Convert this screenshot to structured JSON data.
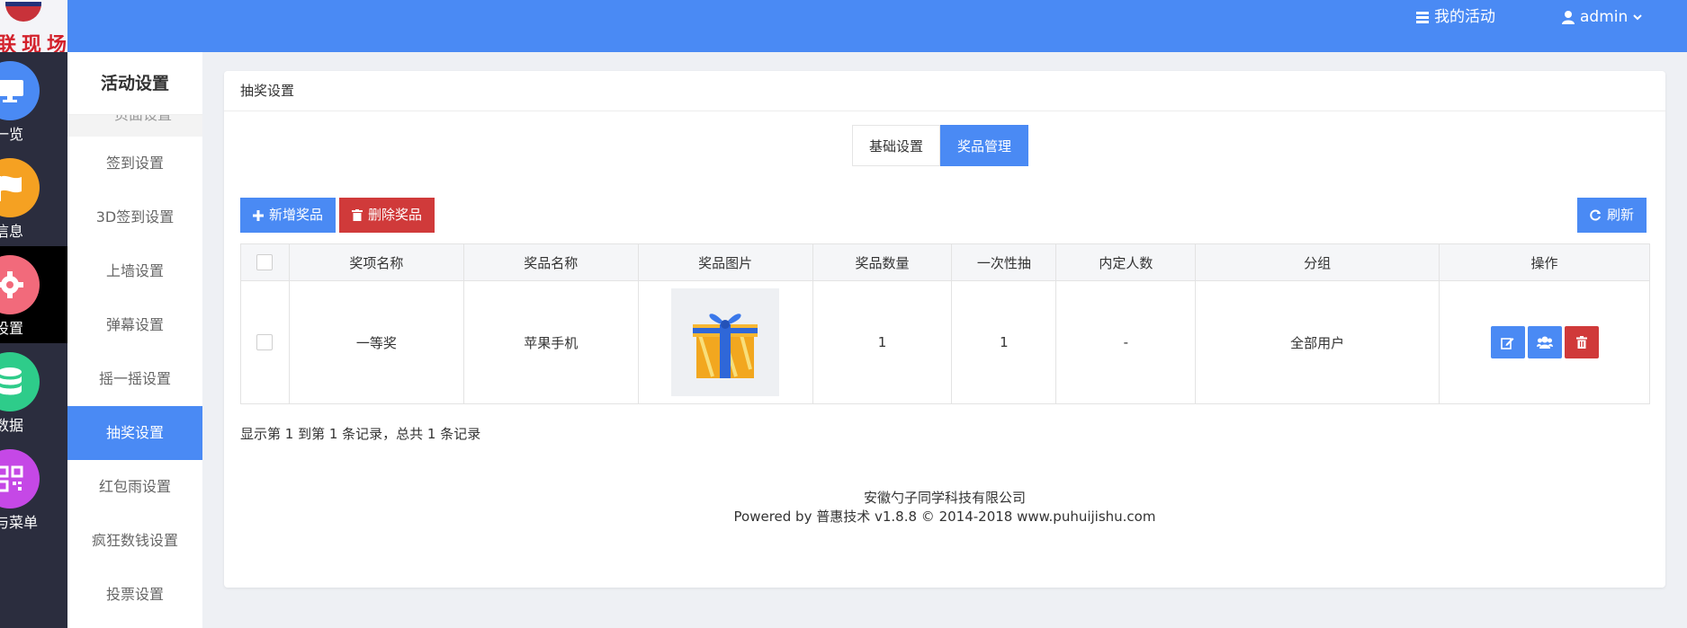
{
  "header": {
    "logo_text": "联现场",
    "my_activity_label": "我的活动",
    "user_label": "admin"
  },
  "rail": {
    "items": [
      {
        "label": "动一览",
        "icon": "monitor-icon",
        "color": "#4a8af4"
      },
      {
        "label": "础信息",
        "icon": "flag-icon",
        "color": "#f5a122"
      },
      {
        "label": "动设置",
        "icon": "gear-icon",
        "color": "#f26a7b"
      },
      {
        "label": "动数据",
        "icon": "database-icon",
        "color": "#2ecc8a"
      },
      {
        "label": "接与菜单",
        "icon": "qrcode-icon",
        "color": "#c548e6"
      }
    ]
  },
  "submenu": {
    "title": "活动设置",
    "partial_item": "页面设置",
    "items": [
      {
        "label": "签到设置"
      },
      {
        "label": "3D签到设置"
      },
      {
        "label": "上墙设置"
      },
      {
        "label": "弹幕设置"
      },
      {
        "label": "摇一摇设置"
      },
      {
        "label": "抽奖设置"
      },
      {
        "label": "红包雨设置"
      },
      {
        "label": "疯狂数钱设置"
      },
      {
        "label": "投票设置"
      }
    ]
  },
  "panel": {
    "title": "抽奖设置",
    "tabs": [
      {
        "label": "基础设置"
      },
      {
        "label": "奖品管理"
      }
    ],
    "add_button": "新增奖品",
    "delete_button": "删除奖品",
    "refresh_button": "刷新",
    "columns": [
      "奖项名称",
      "奖品名称",
      "奖品图片",
      "奖品数量",
      "一次性抽",
      "内定人数",
      "分组",
      "操作"
    ],
    "rows": [
      {
        "award": "一等奖",
        "prize": "苹果手机",
        "image": "gift-box-image",
        "quantity": "1",
        "one_time": "1",
        "preset": "-",
        "group": "全部用户"
      }
    ],
    "summary": "显示第 1 到第 1 条记录，总共 1 条记录",
    "footer_company": "安徽勺子同学科技有限公司",
    "footer_powered": "Powered by 普惠技术 v1.8.8 © 2014-2018 www.puhuijishu.com"
  },
  "colors": {
    "primary": "#4a8af4",
    "danger": "#d03a3a",
    "rail_bg": "#2b2d3e"
  }
}
